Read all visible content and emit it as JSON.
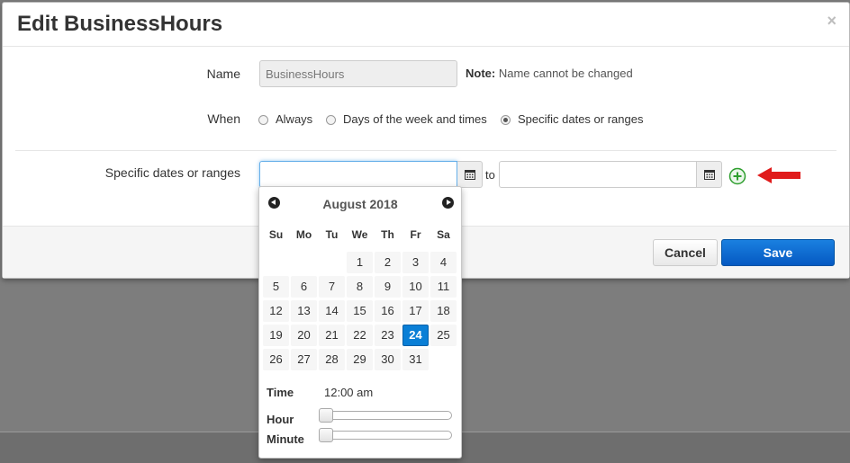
{
  "dialog": {
    "title": "Edit BusinessHours",
    "close_label": "×"
  },
  "form": {
    "name_label": "Name",
    "name_value": "BusinessHours",
    "note_prefix": "Note:",
    "note_text": " Name cannot be changed",
    "when_label": "When",
    "when_options": [
      {
        "label": "Always",
        "checked": false
      },
      {
        "label": "Days of the week and times",
        "checked": false
      },
      {
        "label": "Specific dates or ranges",
        "checked": true
      }
    ],
    "dates_label": "Specific dates or ranges",
    "from_value": "",
    "to_label": "to",
    "to_value": ""
  },
  "footer": {
    "cancel_label": "Cancel",
    "save_label": "Save"
  },
  "datepicker": {
    "month_title": "August 2018",
    "weekdays": [
      "Su",
      "Mo",
      "Tu",
      "We",
      "Th",
      "Fr",
      "Sa"
    ],
    "first_weekday_index": 3,
    "days_in_month": 31,
    "selected_day": 24,
    "time_label": "Time",
    "time_value": "12:00 am",
    "hour_label": "Hour",
    "minute_label": "Minute",
    "hour_value": 0,
    "minute_value": 0
  },
  "colors": {
    "accent": "#0a7fd6",
    "save_button": "#0559c2",
    "add_icon": "#2e9e2e",
    "annotation_arrow": "#e01b1b"
  },
  "icons": {
    "calendar": "calendar-icon",
    "add": "add-circle-icon",
    "annotation": "red-arrow-icon"
  }
}
